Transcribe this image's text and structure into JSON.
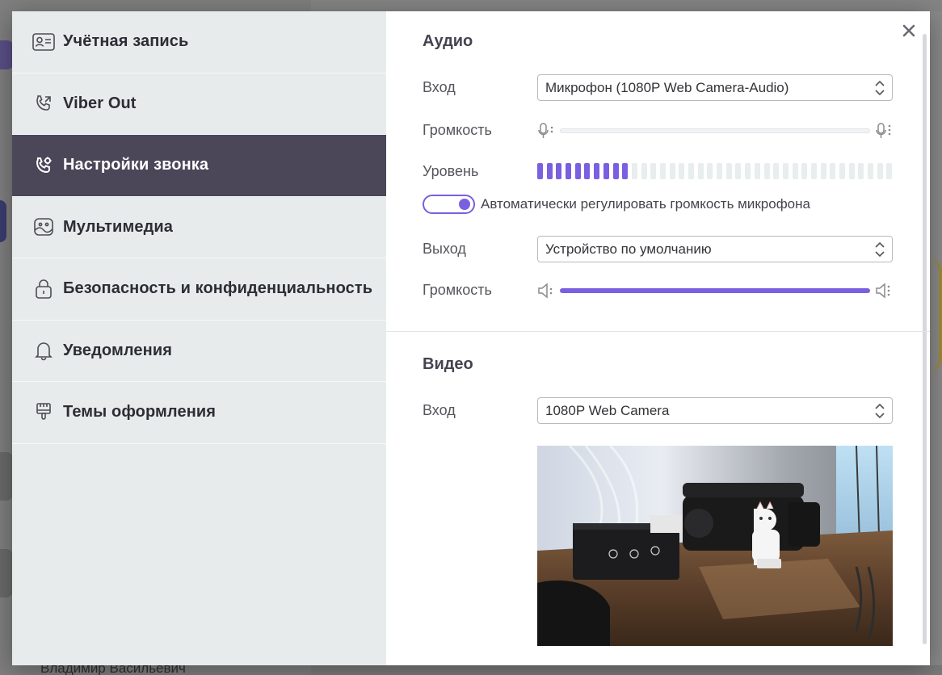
{
  "background": {
    "contact_name": "Владимир Васильевич"
  },
  "sidebar": {
    "items": [
      {
        "label": "Учётная запись",
        "icon": "account-card-icon",
        "active": false
      },
      {
        "label": "Viber Out",
        "icon": "phone-out-icon",
        "active": false
      },
      {
        "label": "Настройки звонка",
        "icon": "call-settings-icon",
        "active": true
      },
      {
        "label": "Мультимедиа",
        "icon": "image-icon",
        "active": false
      },
      {
        "label": "Безопасность и конфиденциальность",
        "icon": "lock-icon",
        "active": false
      },
      {
        "label": "Уведомления",
        "icon": "bell-icon",
        "active": false
      },
      {
        "label": "Темы оформления",
        "icon": "paint-brush-icon",
        "active": false
      }
    ]
  },
  "audio": {
    "title": "Аудио",
    "input_label": "Вход",
    "input_value": "Микрофон (1080P Web Camera-Audio)",
    "input_volume_label": "Громкость",
    "input_volume": 0,
    "level_label": "Уровень",
    "level_bars_total": 38,
    "level_bars_active": 10,
    "auto_gain_label": "Автоматически регулировать громкость микрофона",
    "auto_gain_enabled": true,
    "output_label": "Выход",
    "output_value": "Устройство по умолчанию",
    "output_volume_label": "Громкость",
    "output_volume": 1.0
  },
  "video": {
    "title": "Видео",
    "input_label": "Вход",
    "input_value": "1080P Web Camera"
  },
  "colors": {
    "accent": "#7a5fe0",
    "sidebar_bg": "#e7ebeb",
    "sidebar_active_bg": "#4b4658"
  }
}
